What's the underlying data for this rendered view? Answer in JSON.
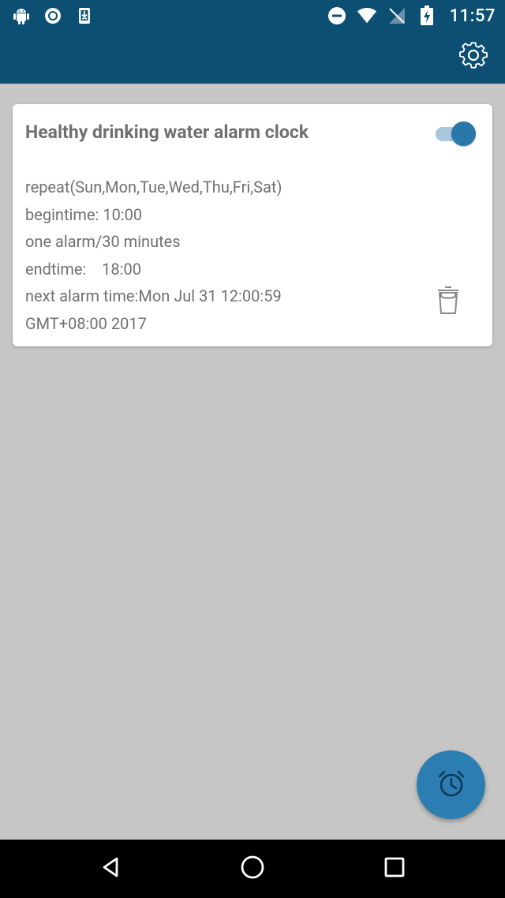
{
  "status_bar": {
    "time": "11:57",
    "left_icons": [
      "android-debug-icon",
      "sync-icon",
      "download-icon"
    ],
    "right_icons": [
      "do-not-disturb-icon",
      "wifi-icon",
      "no-signal-icon",
      "battery-charging-icon"
    ]
  },
  "app_bar": {
    "background": "#0d4f73",
    "settings_icon": "gear-icon"
  },
  "alarm_card": {
    "title": "Healthy drinking water alarm clock",
    "enabled": true,
    "repeat": "repeat(Sun,Mon,Tue,Wed,Thu,Fri,Sat)",
    "begintime": "begintime: 10:00",
    "interval": "one alarm/30 minutes",
    "endtime": "endtime:    18:00",
    "next_alarm_line1": "next alarm time:Mon Jul 31 12:00:59",
    "next_alarm_line2": "GMT+08:00 2017",
    "delete_icon": "trash-icon"
  },
  "fab": {
    "icon": "alarm-clock-icon",
    "color": "#2c7db1"
  },
  "nav_bar": {
    "buttons": [
      "back-icon",
      "home-icon",
      "recents-icon"
    ]
  },
  "colors": {
    "background": "#c6c6c6",
    "accent": "#2a77a9",
    "text": "#707070"
  }
}
